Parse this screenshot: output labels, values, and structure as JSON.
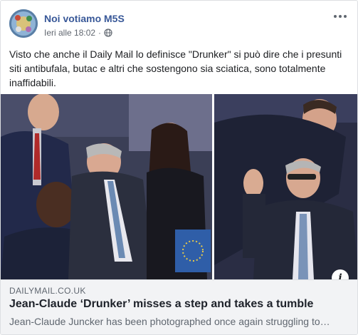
{
  "post": {
    "page_name": "Noi votiamo M5S",
    "timestamp": "Ieri alle 18:02",
    "privacy_icon": "globe-icon",
    "more_icon": "more-options-icon",
    "text": "Visto che anche il Daily Mail lo definisce \"Drunker\" si può dire che i presunti siti antibufala, butac e altri che sostengono sia sciatica, sono totalmente inaffidabili."
  },
  "link_preview": {
    "domain": "DAILYMAIL.CO.UK",
    "headline": "Jean-Claude ‘Drunker’ misses a step and takes a tumble",
    "description": "Jean-Claude Juncker has been photographed once again struggling to…",
    "info_icon": "info-icon",
    "info_glyph": "i"
  },
  "colors": {
    "page_name": "#385898",
    "link_box_bg": "#f2f3f5",
    "muted_text": "#606770"
  }
}
